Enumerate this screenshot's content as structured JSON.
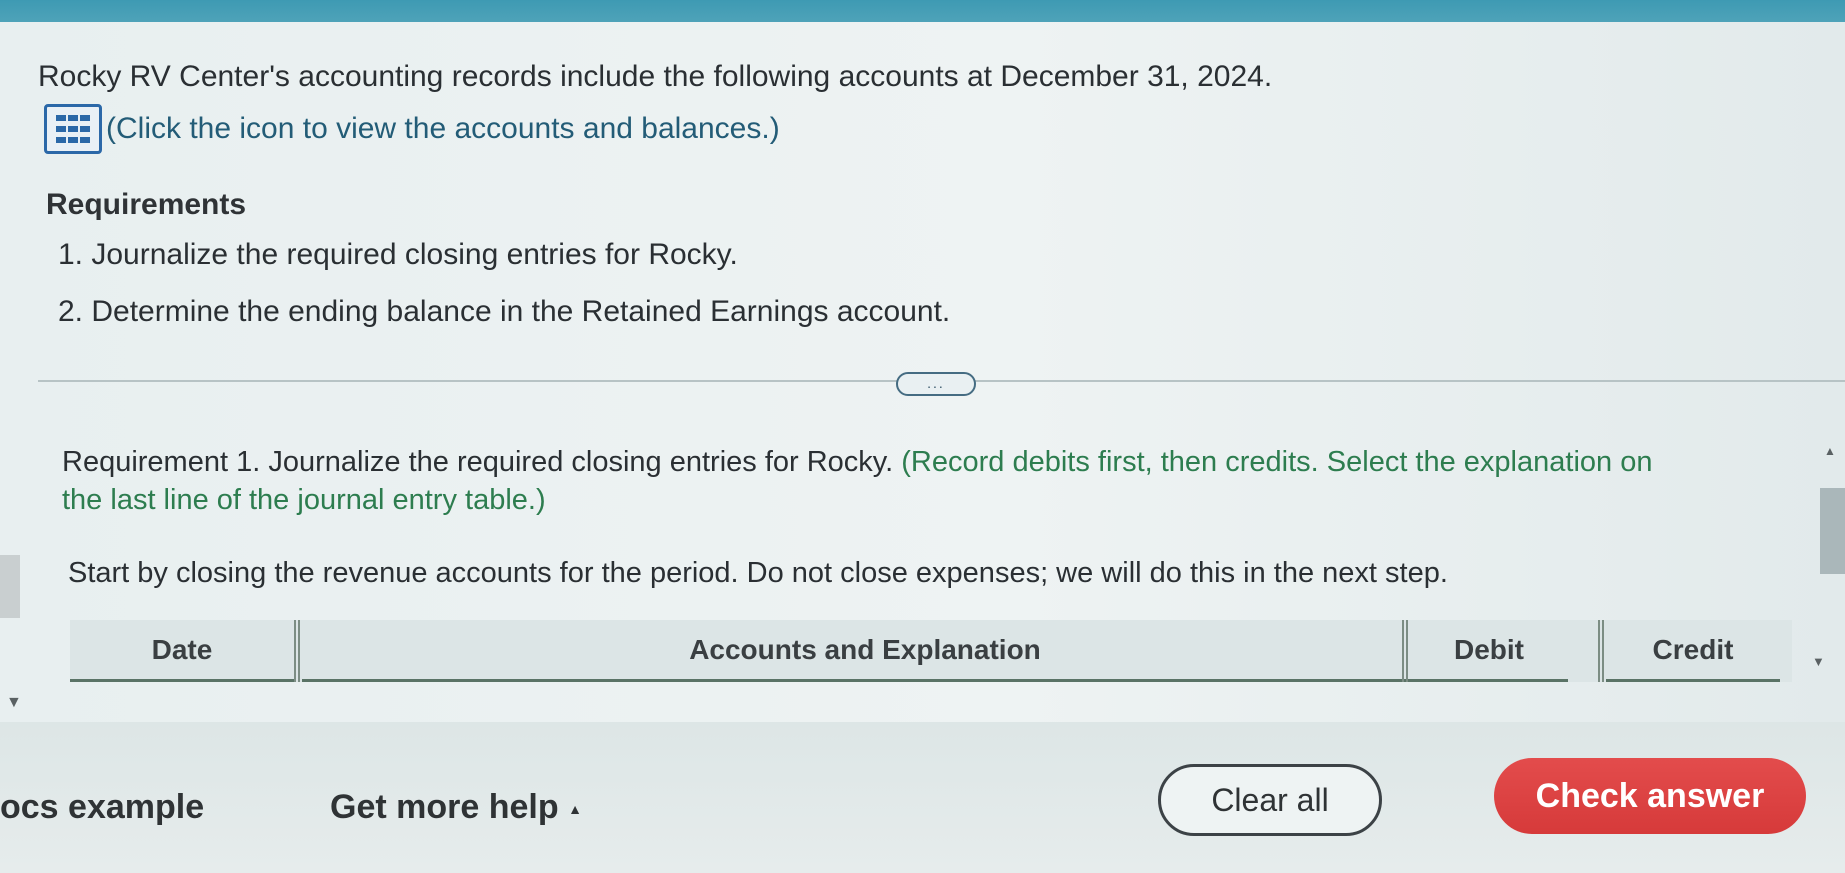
{
  "intro": {
    "text": "Rocky RV Center's accounting records include the following accounts at December 31, 2024.",
    "icon_caption": "(Click the icon to view the accounts and balances.)",
    "icon": "data-table-icon"
  },
  "requirements": {
    "heading": "Requirements",
    "items": [
      "1. Journalize the required closing entries for Rocky.",
      "2. Determine the ending balance in the Retained Earnings account."
    ]
  },
  "more_button": "...",
  "requirement1": {
    "lead": "Requirement 1.",
    "text": " Journalize the required closing entries for Rocky.",
    "instruction": " (Record debits first, then credits. Select the explanation on the last line of the journal entry table.)"
  },
  "start_text": "Start by closing the revenue accounts for the period. Do not close expenses; we will do this in the next step.",
  "journal_table": {
    "columns": [
      "Date",
      "Accounts and Explanation",
      "Debit",
      "Credit"
    ]
  },
  "footer": {
    "docs_example": "ocs example",
    "get_more_help": "Get more help",
    "get_more_help_icon": "caret-up-icon",
    "clear_all": "Clear all",
    "check_answer": "Check answer"
  },
  "colors": {
    "accent_blue": "#2b68a8",
    "check_button": "#dd4343",
    "green_text": "#2d7d4f"
  }
}
